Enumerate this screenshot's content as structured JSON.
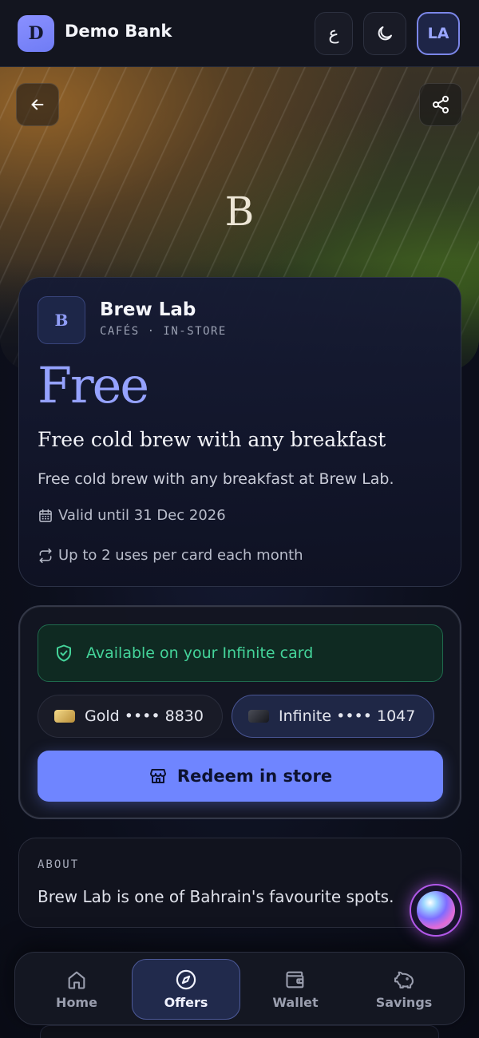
{
  "header": {
    "logo_letter": "D",
    "bank_name": "Demo Bank",
    "language_label": "ع",
    "avatar_initials": "LA"
  },
  "hero": {
    "initial": "B"
  },
  "merchant": {
    "logo_letter": "B",
    "name": "Brew Lab",
    "category": "CAFÉS · IN-STORE"
  },
  "offer": {
    "headline": "Free",
    "title": "Free cold brew with any breakfast",
    "description": "Free cold brew with any breakfast at Brew Lab.",
    "validity": "Valid until 31 Dec 2026",
    "usage": "Up to 2 uses per card each month"
  },
  "eligibility": {
    "message": "Available on your Infinite card",
    "cards": [
      {
        "name": "Gold",
        "masked": "•••• 8830",
        "selected": false
      },
      {
        "name": "Infinite",
        "masked": "•••• 1047",
        "selected": true
      }
    ],
    "redeem_label": "Redeem in store"
  },
  "about": {
    "label": "ABOUT",
    "text": "Brew Lab is one of Bahrain's favourite spots."
  },
  "nav": {
    "items": [
      {
        "label": "Home",
        "icon": "home-icon"
      },
      {
        "label": "Offers",
        "icon": "compass-icon",
        "active": true
      },
      {
        "label": "Wallet",
        "icon": "wallet-icon"
      },
      {
        "label": "Savings",
        "icon": "piggy-bank-icon"
      }
    ]
  },
  "colors": {
    "accent": "#6f85ff",
    "offer_text": "#95a2ff",
    "available_green": "#44d49a",
    "assistant_glow": "#b158e8"
  }
}
